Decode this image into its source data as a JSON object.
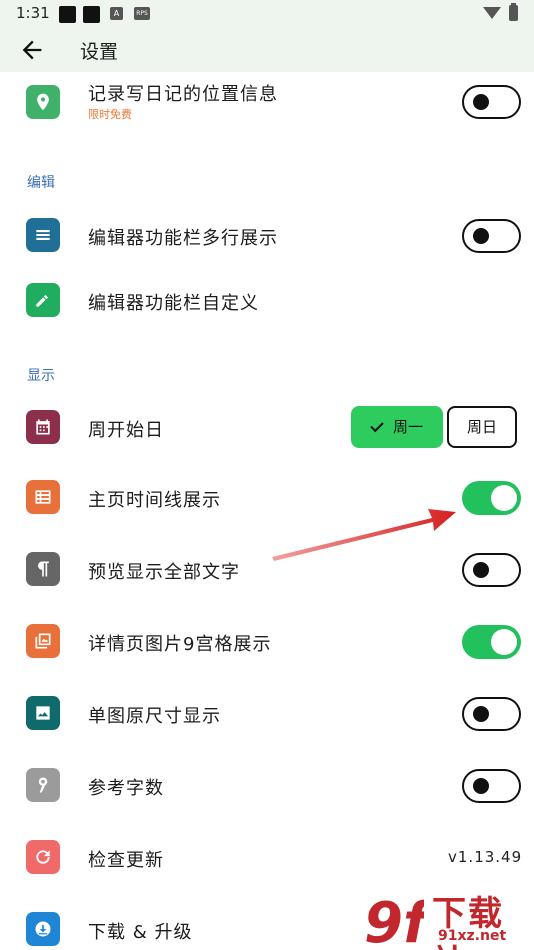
{
  "status_bar": {
    "time": "1:31",
    "icon_a": "A",
    "icon_rps": "RPS"
  },
  "app_bar": {
    "title": "设置"
  },
  "rows_top": [
    {
      "label": "记录写日记的位置信息",
      "sub": "限时免费",
      "icon": "location-pin-icon",
      "icon_color": "#3fb16b",
      "toggle": "off"
    }
  ],
  "sections": [
    {
      "header": "编辑"
    },
    {
      "header": "显示"
    }
  ],
  "edit_rows": [
    {
      "label": "编辑器功能栏多行展示",
      "icon": "menu-lines-icon",
      "icon_color": "#1f6f97",
      "toggle": "off"
    },
    {
      "label": "编辑器功能栏自定义",
      "icon": "pencil-icon",
      "icon_color": "#21ad5f"
    }
  ],
  "display_rows": [
    {
      "label": "周开始日",
      "icon": "calendar-icon",
      "icon_color": "#8b2f4a",
      "segment": {
        "selected": "周一",
        "other": "周日"
      }
    },
    {
      "label": "主页时间线展示",
      "icon": "list-icon",
      "icon_color": "#e8703a",
      "toggle": "on"
    },
    {
      "label": "预览显示全部文字",
      "icon": "pilcrow-icon",
      "icon_color": "#666666",
      "toggle": "off"
    },
    {
      "label": "详情页图片9宫格展示",
      "icon": "photo-library-icon",
      "icon_color": "#e8703a",
      "toggle": "on"
    },
    {
      "label": "单图原尺寸显示",
      "icon": "image-icon",
      "icon_color": "#0f6b6b",
      "toggle": "off"
    },
    {
      "label": "参考字数",
      "icon": "number-nine-icon",
      "icon_color": "#9b9b9b",
      "toggle": "off"
    },
    {
      "label": "检查更新",
      "icon": "refresh-icon",
      "icon_color": "#f06a6a",
      "value": "v1.13.49"
    },
    {
      "label": "下载 & 升级",
      "icon": "download-icon",
      "icon_color": "#1f86d6"
    }
  ],
  "colors": {
    "accent_green": "#22c15e",
    "section_blue": "#3d6fb8",
    "header_bg": "#eef5ee",
    "annotation_red": "#d62020"
  },
  "watermark": {
    "brand": "下载站",
    "domain": "91xz.net",
    "logo": "9f"
  }
}
